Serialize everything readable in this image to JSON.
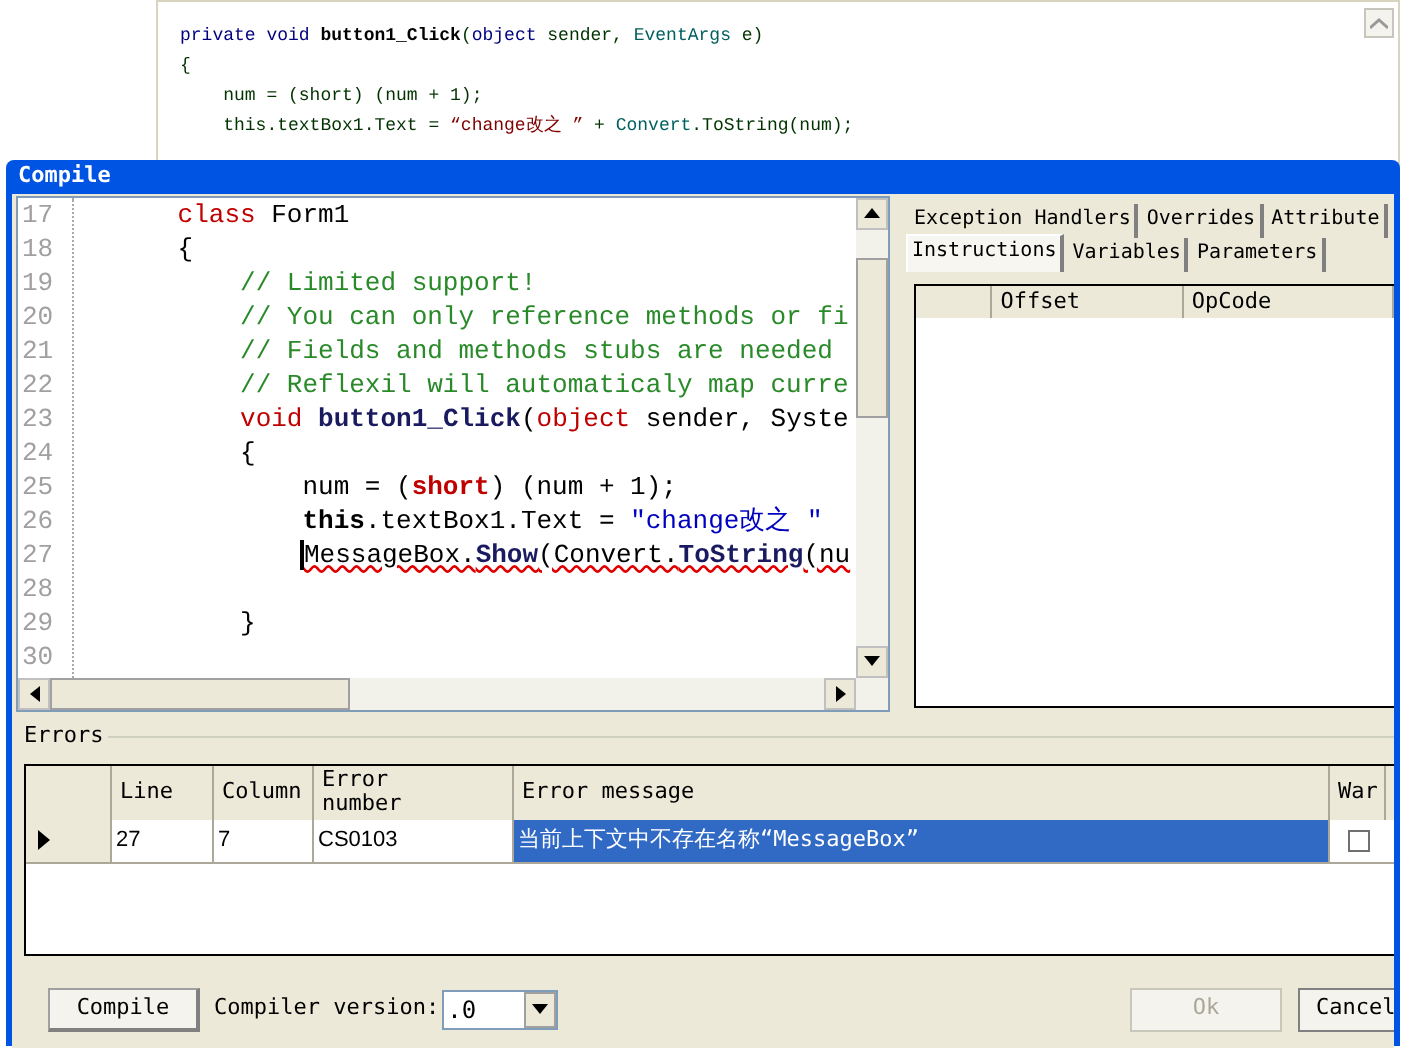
{
  "background_code": {
    "lines": [
      [
        {
          "kind": "keyword",
          "text": "private void "
        },
        {
          "kind": "method",
          "text": "button1_Click"
        },
        {
          "kind": "plain",
          "text": "("
        },
        {
          "kind": "keyword",
          "text": "object"
        },
        {
          "kind": "plain",
          "text": " sender, "
        },
        {
          "kind": "type",
          "text": "EventArgs"
        },
        {
          "kind": "plain",
          "text": " e)"
        }
      ],
      [
        {
          "kind": "plain",
          "text": "{"
        }
      ],
      [
        {
          "kind": "plain",
          "text": "    num = (short) (num + 1);"
        }
      ],
      [
        {
          "kind": "plain",
          "text": "    this.textBox1.Text = "
        },
        {
          "kind": "literal",
          "text": "“change改之 ”"
        },
        {
          "kind": "plain",
          "text": " + "
        },
        {
          "kind": "type",
          "text": "Convert"
        },
        {
          "kind": "plain",
          "text": ".ToString(num);"
        }
      ]
    ]
  },
  "dialog": {
    "title": "Compile",
    "editor": {
      "lines": [
        {
          "number": "17",
          "error": false,
          "segments": [
            {
              "kind": "keyword",
              "text": "      class"
            },
            {
              "kind": "plain",
              "text": " Form1"
            }
          ]
        },
        {
          "number": "18",
          "error": false,
          "segments": [
            {
              "kind": "plain",
              "text": "      {"
            }
          ]
        },
        {
          "number": "19",
          "error": false,
          "segments": [
            {
              "kind": "comment",
              "text": "          // Limited support!"
            }
          ]
        },
        {
          "number": "20",
          "error": false,
          "segments": [
            {
              "kind": "comment",
              "text": "          // You can only reference methods or fi"
            }
          ]
        },
        {
          "number": "21",
          "error": false,
          "segments": [
            {
              "kind": "comment",
              "text": "          // Fields and methods stubs are needed"
            }
          ]
        },
        {
          "number": "22",
          "error": false,
          "segments": [
            {
              "kind": "comment",
              "text": "          // Reflexil will automaticaly map curre"
            }
          ]
        },
        {
          "number": "23",
          "error": false,
          "segments": [
            {
              "kind": "keyword",
              "text": "          void "
            },
            {
              "kind": "method",
              "text": "button1_Click"
            },
            {
              "kind": "plain",
              "text": "("
            },
            {
              "kind": "keyword",
              "text": "object"
            },
            {
              "kind": "plain",
              "text": " sender, Syste"
            }
          ]
        },
        {
          "number": "24",
          "error": false,
          "segments": [
            {
              "kind": "plain",
              "text": "          {"
            }
          ]
        },
        {
          "number": "25",
          "error": false,
          "segments": [
            {
              "kind": "plain",
              "text": "              num = ("
            },
            {
              "kind": "strong",
              "text": "short"
            },
            {
              "kind": "plain",
              "text": ") (num + 1);"
            }
          ]
        },
        {
          "number": "26",
          "error": false,
          "segments": [
            {
              "kind": "bold",
              "text": "              this"
            },
            {
              "kind": "plain",
              "text": ".textBox1.Text = "
            },
            {
              "kind": "string",
              "text": "\"change改之 \""
            }
          ]
        },
        {
          "number": "27",
          "error": true,
          "segments": [
            {
              "kind": "plain",
              "text": "MessageBox."
            },
            {
              "kind": "method",
              "text": "Show"
            },
            {
              "kind": "plain",
              "text": "(Convert."
            },
            {
              "kind": "method",
              "text": "ToString"
            },
            {
              "kind": "plain",
              "text": "(nu"
            }
          ]
        },
        {
          "number": "28"
        },
        {
          "number": "29",
          "error": false,
          "segments": [
            {
              "kind": "plain",
              "text": "          }"
            }
          ]
        },
        {
          "number": "30"
        }
      ]
    },
    "tab_rows": [
      [
        {
          "label": "Exception Handlers",
          "selected": false
        },
        {
          "label": "Overrides",
          "selected": false
        },
        {
          "label": "Attribute",
          "selected": false
        }
      ],
      [
        {
          "label": "Instructions",
          "selected": true
        },
        {
          "label": "Variables",
          "selected": false
        },
        {
          "label": "Parameters",
          "selected": false
        }
      ]
    ],
    "instructions_table": {
      "columns": [
        "Offset",
        "OpCode"
      ]
    },
    "errors": {
      "title": "Errors",
      "columns": [
        "Line",
        "Column",
        "Error\nnumber",
        "Error message",
        "War"
      ],
      "rows": [
        {
          "current": true,
          "warning": false,
          "cells": [
            "27",
            "7",
            "CS0103",
            "当前上下文中不存在名称“MessageBox”"
          ]
        }
      ]
    },
    "compile_button": "Compile",
    "compiler_version_label": "Compiler version:",
    "compiler_version_value": ".0",
    "ok_button": {
      "label": "Ok",
      "disabled": true
    },
    "cancel_button": "Cancel"
  }
}
